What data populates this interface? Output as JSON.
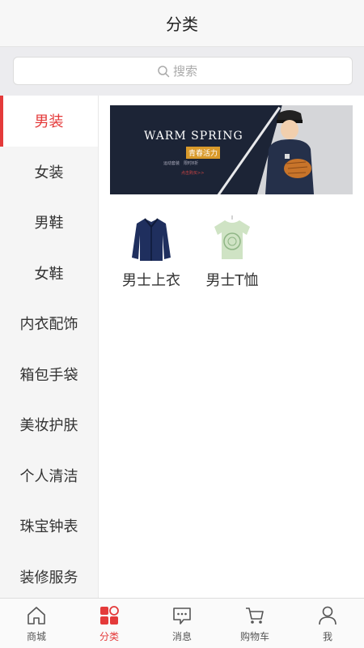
{
  "header": {
    "title": "分类"
  },
  "search": {
    "placeholder": "搜索"
  },
  "sidebar": {
    "items": [
      {
        "label": "男装",
        "active": true
      },
      {
        "label": "女装"
      },
      {
        "label": "男鞋"
      },
      {
        "label": "女鞋"
      },
      {
        "label": "内衣配饰"
      },
      {
        "label": "箱包手袋"
      },
      {
        "label": "美妆护肤"
      },
      {
        "label": "个人清洁"
      },
      {
        "label": "珠宝钟表"
      },
      {
        "label": "装修服务"
      }
    ]
  },
  "banner": {
    "headline": "WARM SPRING",
    "badge": "青春活力",
    "sub": "运动套装　限时8折",
    "button": "点击购买>>"
  },
  "products": [
    {
      "name": "男士上衣",
      "icon": "jacket-icon"
    },
    {
      "name": "男士T恤",
      "icon": "tshirt-icon"
    }
  ],
  "tabbar": {
    "items": [
      {
        "label": "商城",
        "icon": "home-icon"
      },
      {
        "label": "分类",
        "icon": "category-icon",
        "active": true
      },
      {
        "label": "消息",
        "icon": "message-icon"
      },
      {
        "label": "购物车",
        "icon": "cart-icon"
      },
      {
        "label": "我",
        "icon": "user-icon"
      }
    ]
  },
  "colors": {
    "accent": "#e43a3a",
    "banner_bg": "#1c2436"
  }
}
